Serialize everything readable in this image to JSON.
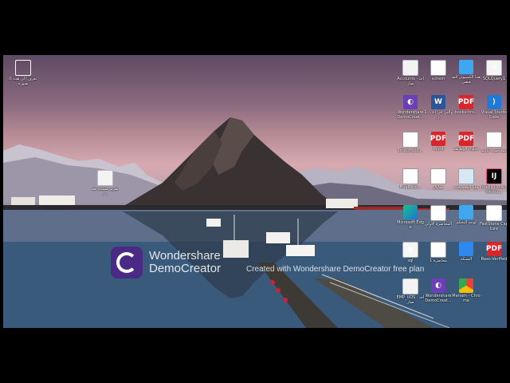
{
  "watermark": {
    "brand_line1": "Wondershare",
    "brand_line2": "DemoCreator",
    "overlay_text": "Created with Wondershare DemoCreator free plan"
  },
  "desktop": {
    "left_icons": [
      {
        "label": "تعرف إلى هذه الصورة",
        "icon": "info-circle-icon"
      },
      {
        "label": "تقرير مستند نصي",
        "icon": "text-document-icon"
      }
    ],
    "grid_icons": [
      {
        "label": "Accounts - اختصار",
        "icon": "file-icon"
      },
      {
        "label": "schem",
        "icon": "text-document-icon"
      },
      {
        "label": "هذا الكمبيوتر الشخصي",
        "icon": "computer-icon"
      },
      {
        "label": "SQLQuery1",
        "icon": "sql-file-icon"
      },
      {
        "label": "Wondershare DemoCreat...",
        "icon": "democreator-icon"
      },
      {
        "label": "1 .. والتي في أكثر",
        "icon": "word-icon"
      },
      {
        "label": "books-hrs...",
        "icon": "pdf-icon"
      },
      {
        "label": "Visual Studio Code",
        "icon": "vscode-icon"
      },
      {
        "label": "brabs_cod...",
        "icon": "text-document-icon"
      },
      {
        "label": "Word",
        "icon": "pdf-icon"
      },
      {
        "label": "جداول الوظائف",
        "icon": "pdf-icon"
      },
      {
        "label": "المحاضرة الثانية",
        "icon": "text-document-icon"
      },
      {
        "label": "Final_sco...",
        "icon": "text-document-icon"
      },
      {
        "label": "جداول",
        "icon": "text-document-icon"
      },
      {
        "label": "سلة المحذوفات",
        "icon": "recycle-bin-icon"
      },
      {
        "label": "IntelliJ IDEA Commu...",
        "icon": "intellij-icon"
      },
      {
        "label": "Microsoft Edge",
        "icon": "edge-icon"
      },
      {
        "label": "المحاضرة الأولى",
        "icon": "text-document-icon"
      },
      {
        "label": "لوحة التحكم",
        "icon": "control-panel-icon"
      },
      {
        "label": "FastStone Capture",
        "icon": "faststone-icon"
      },
      {
        "label": "sql",
        "icon": "sql-file-icon"
      },
      {
        "label": "محاضرة 1",
        "icon": "text-document-icon"
      },
      {
        "label": "الشبكة",
        "icon": "network-icon"
      },
      {
        "label": "Bees-Verified",
        "icon": "pdf-icon"
      },
      {
        "label": "EMP_UDS - اختصار",
        "icon": "file-icon"
      },
      {
        "label": "Wondershare DemoCreat...",
        "icon": "democreator-icon"
      },
      {
        "label": "Mariam - Chrome",
        "icon": "chrome-icon"
      }
    ]
  }
}
